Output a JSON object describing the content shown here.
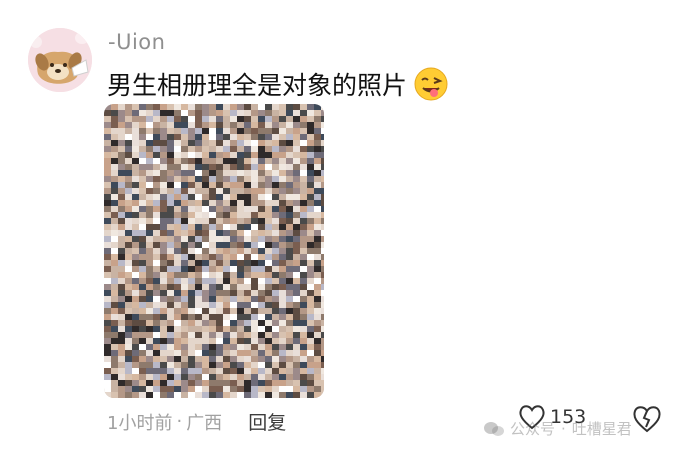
{
  "comment": {
    "username": "-Uion",
    "text": "男生相册理全是对象的照片",
    "emoji": "winking-face-with-tongue-icon",
    "image_alt": "photo-collage-thumbnail",
    "time": "1小时前",
    "location": "广西",
    "meta_separator": "·",
    "reply_label": "回复",
    "like_count": "153"
  },
  "watermark": {
    "left": "公众号",
    "separator": "·",
    "right": "吐槽星君"
  },
  "colors": {
    "username": "#8f8f8f",
    "meta": "#a1a1a1",
    "avatar_bg": "#f6dfe4"
  }
}
